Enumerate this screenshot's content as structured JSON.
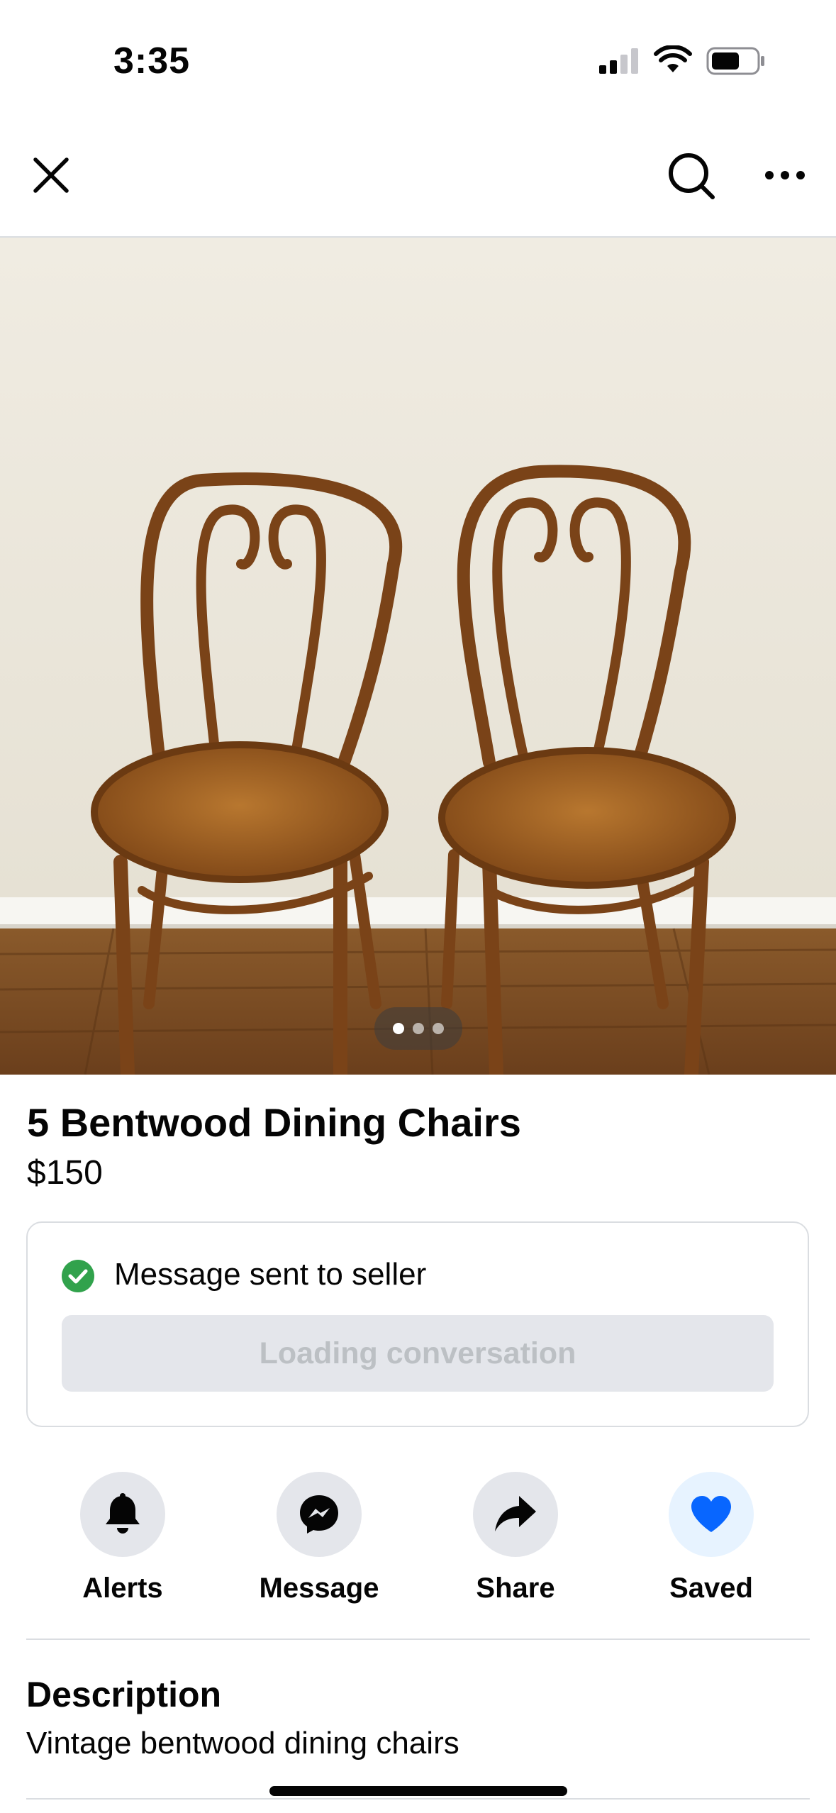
{
  "status_bar": {
    "time": "3:35"
  },
  "photo": {
    "alt": "",
    "pager": {
      "count": 3,
      "active": 0
    }
  },
  "listing": {
    "title": "5 Bentwood Dining Chairs",
    "price": "$150"
  },
  "message_card": {
    "status": "Message sent to seller",
    "button": "Loading conversation"
  },
  "actions": [
    {
      "label": "Alerts",
      "icon": "bell-icon"
    },
    {
      "label": "Message",
      "icon": "messenger-icon"
    },
    {
      "label": "Share",
      "icon": "share-arrow-icon"
    },
    {
      "label": "Saved",
      "icon": "heart-icon"
    }
  ],
  "description": {
    "heading": "Description",
    "text": "Vintage bentwood dining chairs"
  },
  "colors": {
    "accent": "#0866ff",
    "success": "#31a24c",
    "button_bg": "#e4e6eb",
    "saved_bg": "#e7f3ff"
  }
}
